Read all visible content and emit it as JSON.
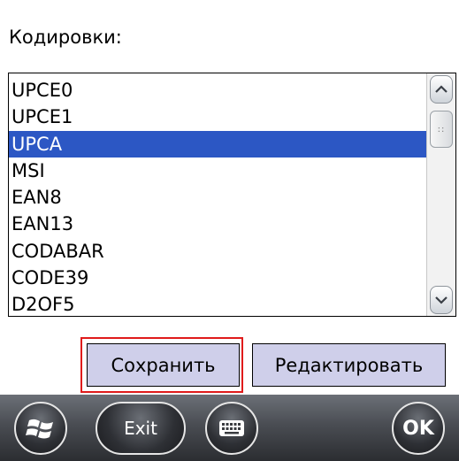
{
  "screen": {
    "label": "Кодировки:"
  },
  "list": {
    "items": [
      "UPCE0",
      "UPCE1",
      "UPCA",
      "MSI",
      "EAN8",
      "EAN13",
      "CODABAR",
      "CODE39",
      "D2OF5"
    ],
    "selected": "UPCA"
  },
  "buttons": {
    "save": "Сохранить",
    "edit": "Редактировать"
  },
  "taskbar": {
    "exit": "Exit",
    "ok": "OK",
    "start_icon": "windows-logo-icon",
    "keyboard_icon": "keyboard-icon"
  },
  "colors": {
    "selection": "#2c57c4",
    "button_bg": "#cfcfea",
    "focus_border": "#e01b1b"
  }
}
